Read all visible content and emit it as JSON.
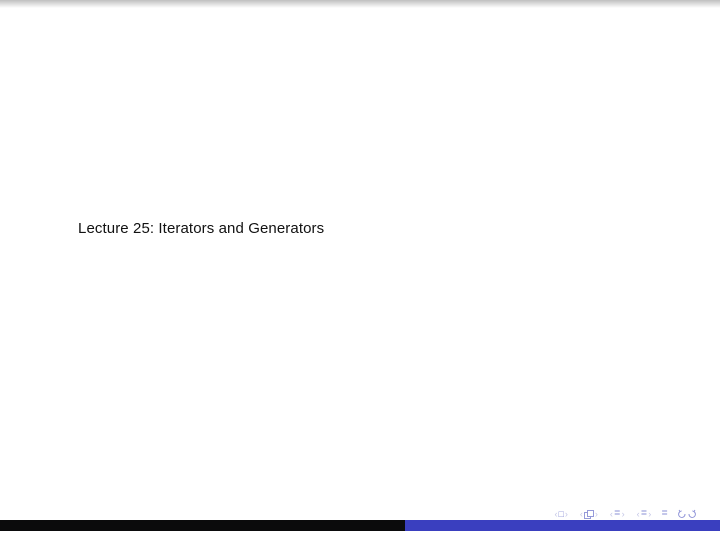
{
  "slide": {
    "title": "Lecture 25: Iterators and Generators"
  },
  "colors": {
    "nav_dim": "#c4c6e6",
    "nav_accent": "#8a8fd6",
    "footer_left": "#0b0b0c",
    "footer_right": "#3a3fbf"
  },
  "nav": {
    "frame_prev_label": "prev-frame",
    "frame_next_label": "next-frame",
    "subsection_prev_label": "prev-subsection",
    "subsection_next_label": "next-subsection",
    "slide_prev_label": "prev-slide",
    "slide_next_label": "next-slide",
    "section_prev_label": "prev-section",
    "section_next_label": "next-section",
    "goto_end_label": "goto-end",
    "back_forward_label": "go-back"
  }
}
